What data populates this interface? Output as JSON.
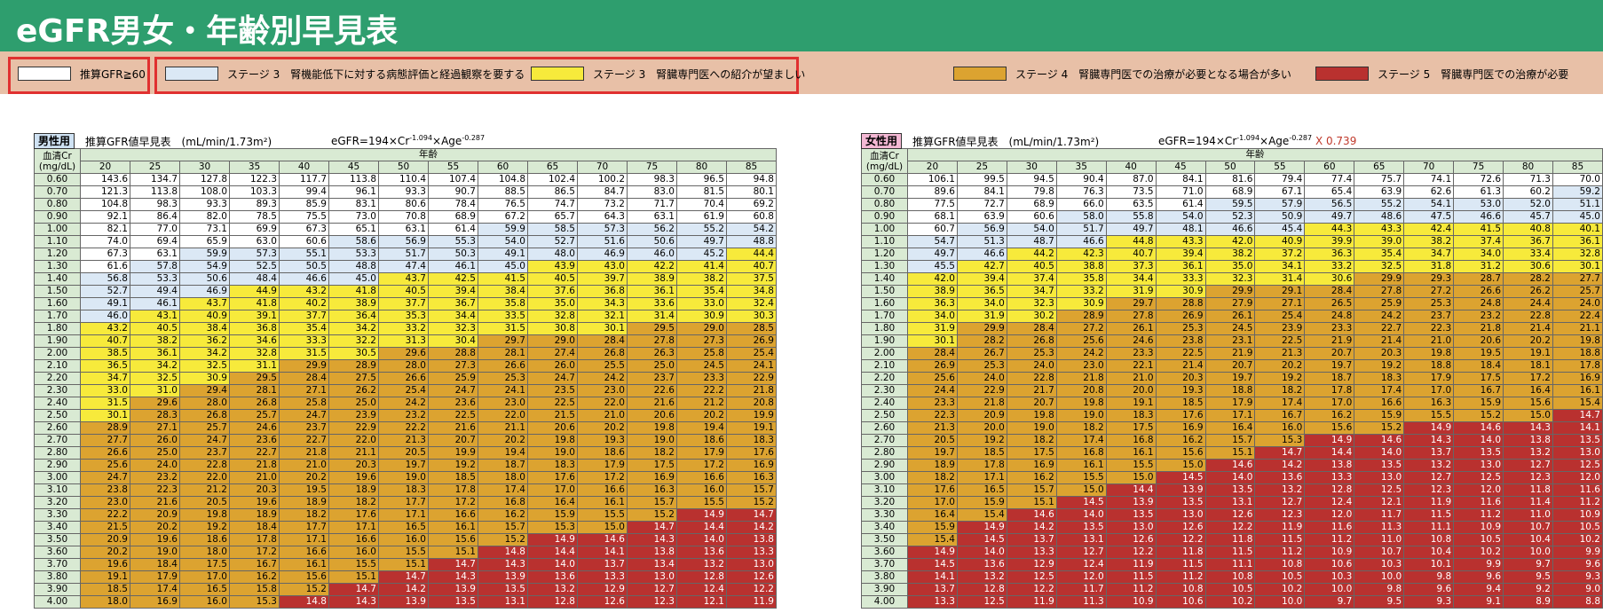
{
  "title": "eGFR男女・年齢別早見表",
  "legend": [
    {
      "label": "推算GFR≧60",
      "color": "#ffffff"
    },
    {
      "label": "ステージ 3　腎機能低下に対する病態評価と経過観察を要する",
      "color": "#dbe8f5"
    },
    {
      "label": "ステージ 3　腎臓専門医への紹介が望ましい",
      "color": "#f7ea3b"
    },
    {
      "label": "ステージ 4　腎臓専門医での治療が必要となる場合が多い",
      "color": "#dca330"
    },
    {
      "label": "ステージ 5　腎臓専門医での治療が必要",
      "color": "#b9312f"
    }
  ],
  "common": {
    "table_title": "推算GFR値早見表　(mL/min/1.73m²)",
    "cr_label_line1": "血清Cr",
    "cr_label_line2": "(mg/dL)",
    "age_label": "年齢",
    "ages": [
      "20",
      "25",
      "30",
      "35",
      "40",
      "45",
      "50",
      "55",
      "60",
      "65",
      "70",
      "75",
      "80",
      "85"
    ],
    "cr": [
      "0.60",
      "0.70",
      "0.80",
      "0.90",
      "1.00",
      "1.10",
      "1.20",
      "1.30",
      "1.40",
      "1.50",
      "1.60",
      "1.70",
      "1.80",
      "1.90",
      "2.00",
      "2.10",
      "2.20",
      "2.30",
      "2.40",
      "2.50",
      "2.60",
      "2.70",
      "2.80",
      "2.90",
      "3.00",
      "3.10",
      "3.20",
      "3.30",
      "3.40",
      "3.50",
      "3.60",
      "3.70",
      "3.80",
      "3.90",
      "4.00"
    ]
  },
  "male": {
    "tag": "男性用",
    "formula_base": "eGFR=194×Cr",
    "formula_exp1": "-1.094",
    "formula_mid": "×Age",
    "formula_exp2": "-0.287",
    "formula_mult": "",
    "tag_color": "#cfe2f3",
    "rows": [
      [
        "143.6",
        "134.7",
        "127.8",
        "122.3",
        "117.7",
        "113.8",
        "110.4",
        "107.4",
        "104.8",
        "102.4",
        "100.2",
        "98.3",
        "96.5",
        "94.8"
      ],
      [
        "121.3",
        "113.8",
        "108.0",
        "103.3",
        "99.4",
        "96.1",
        "93.3",
        "90.7",
        "88.5",
        "86.5",
        "84.7",
        "83.0",
        "81.5",
        "80.1"
      ],
      [
        "104.8",
        "98.3",
        "93.3",
        "89.3",
        "85.9",
        "83.1",
        "80.6",
        "78.4",
        "76.5",
        "74.7",
        "73.2",
        "71.7",
        "70.4",
        "69.2"
      ],
      [
        "92.1",
        "86.4",
        "82.0",
        "78.5",
        "75.5",
        "73.0",
        "70.8",
        "68.9",
        "67.2",
        "65.7",
        "64.3",
        "63.1",
        "61.9",
        "60.8"
      ],
      [
        "82.1",
        "77.0",
        "73.1",
        "69.9",
        "67.3",
        "65.1",
        "63.1",
        "61.4",
        "59.9",
        "58.5",
        "57.3",
        "56.2",
        "55.2",
        "54.2"
      ],
      [
        "74.0",
        "69.4",
        "65.9",
        "63.0",
        "60.6",
        "58.6",
        "56.9",
        "55.3",
        "54.0",
        "52.7",
        "51.6",
        "50.6",
        "49.7",
        "48.8"
      ],
      [
        "67.3",
        "63.1",
        "59.9",
        "57.3",
        "55.1",
        "53.3",
        "51.7",
        "50.3",
        "49.1",
        "48.0",
        "46.9",
        "46.0",
        "45.2",
        "44.4"
      ],
      [
        "61.6",
        "57.8",
        "54.9",
        "52.5",
        "50.5",
        "48.8",
        "47.4",
        "46.1",
        "45.0",
        "43.9",
        "43.0",
        "42.2",
        "41.4",
        "40.7"
      ],
      [
        "56.8",
        "53.3",
        "50.6",
        "48.4",
        "46.6",
        "45.0",
        "43.7",
        "42.5",
        "41.5",
        "40.5",
        "39.7",
        "38.9",
        "38.2",
        "37.5"
      ],
      [
        "52.7",
        "49.4",
        "46.9",
        "44.9",
        "43.2",
        "41.8",
        "40.5",
        "39.4",
        "38.4",
        "37.6",
        "36.8",
        "36.1",
        "35.4",
        "34.8"
      ],
      [
        "49.1",
        "46.1",
        "43.7",
        "41.8",
        "40.2",
        "38.9",
        "37.7",
        "36.7",
        "35.8",
        "35.0",
        "34.3",
        "33.6",
        "33.0",
        "32.4"
      ],
      [
        "46.0",
        "43.1",
        "40.9",
        "39.1",
        "37.7",
        "36.4",
        "35.3",
        "34.4",
        "33.5",
        "32.8",
        "32.1",
        "31.4",
        "30.9",
        "30.3"
      ],
      [
        "43.2",
        "40.5",
        "38.4",
        "36.8",
        "35.4",
        "34.2",
        "33.2",
        "32.3",
        "31.5",
        "30.8",
        "30.1",
        "29.5",
        "29.0",
        "28.5"
      ],
      [
        "40.7",
        "38.2",
        "36.2",
        "34.6",
        "33.3",
        "32.2",
        "31.3",
        "30.4",
        "29.7",
        "29.0",
        "28.4",
        "27.8",
        "27.3",
        "26.9"
      ],
      [
        "38.5",
        "36.1",
        "34.2",
        "32.8",
        "31.5",
        "30.5",
        "29.6",
        "28.8",
        "28.1",
        "27.4",
        "26.8",
        "26.3",
        "25.8",
        "25.4"
      ],
      [
        "36.5",
        "34.2",
        "32.5",
        "31.1",
        "29.9",
        "28.9",
        "28.0",
        "27.3",
        "26.6",
        "26.0",
        "25.5",
        "25.0",
        "24.5",
        "24.1"
      ],
      [
        "34.7",
        "32.5",
        "30.9",
        "29.5",
        "28.4",
        "27.5",
        "26.6",
        "25.9",
        "25.3",
        "24.7",
        "24.2",
        "23.7",
        "23.3",
        "22.9"
      ],
      [
        "33.0",
        "31.0",
        "29.4",
        "28.1",
        "27.1",
        "26.2",
        "25.4",
        "24.7",
        "24.1",
        "23.5",
        "23.0",
        "22.6",
        "22.2",
        "21.8"
      ],
      [
        "31.5",
        "29.6",
        "28.0",
        "26.8",
        "25.8",
        "25.0",
        "24.2",
        "23.6",
        "23.0",
        "22.5",
        "22.0",
        "21.6",
        "21.2",
        "20.8"
      ],
      [
        "30.1",
        "28.3",
        "26.8",
        "25.7",
        "24.7",
        "23.9",
        "23.2",
        "22.5",
        "22.0",
        "21.5",
        "21.0",
        "20.6",
        "20.2",
        "19.9"
      ],
      [
        "28.9",
        "27.1",
        "25.7",
        "24.6",
        "23.7",
        "22.9",
        "22.2",
        "21.6",
        "21.1",
        "20.6",
        "20.2",
        "19.8",
        "19.4",
        "19.1"
      ],
      [
        "27.7",
        "26.0",
        "24.7",
        "23.6",
        "22.7",
        "22.0",
        "21.3",
        "20.7",
        "20.2",
        "19.8",
        "19.3",
        "19.0",
        "18.6",
        "18.3"
      ],
      [
        "26.6",
        "25.0",
        "23.7",
        "22.7",
        "21.8",
        "21.1",
        "20.5",
        "19.9",
        "19.4",
        "19.0",
        "18.6",
        "18.2",
        "17.9",
        "17.6"
      ],
      [
        "25.6",
        "24.0",
        "22.8",
        "21.8",
        "21.0",
        "20.3",
        "19.7",
        "19.2",
        "18.7",
        "18.3",
        "17.9",
        "17.5",
        "17.2",
        "16.9"
      ],
      [
        "24.7",
        "23.2",
        "22.0",
        "21.0",
        "20.2",
        "19.6",
        "19.0",
        "18.5",
        "18.0",
        "17.6",
        "17.2",
        "16.9",
        "16.6",
        "16.3"
      ],
      [
        "23.8",
        "22.3",
        "21.2",
        "20.3",
        "19.5",
        "18.9",
        "18.3",
        "17.8",
        "17.4",
        "17.0",
        "16.6",
        "16.3",
        "16.0",
        "15.7"
      ],
      [
        "23.0",
        "21.6",
        "20.5",
        "19.6",
        "18.9",
        "18.2",
        "17.7",
        "17.2",
        "16.8",
        "16.4",
        "16.1",
        "15.7",
        "15.5",
        "15.2"
      ],
      [
        "22.2",
        "20.9",
        "19.8",
        "18.9",
        "18.2",
        "17.6",
        "17.1",
        "16.6",
        "16.2",
        "15.9",
        "15.5",
        "15.2",
        "14.9",
        "14.7"
      ],
      [
        "21.5",
        "20.2",
        "19.2",
        "18.4",
        "17.7",
        "17.1",
        "16.5",
        "16.1",
        "15.7",
        "15.3",
        "15.0",
        "14.7",
        "14.4",
        "14.2"
      ],
      [
        "20.9",
        "19.6",
        "18.6",
        "17.8",
        "17.1",
        "16.6",
        "16.0",
        "15.6",
        "15.2",
        "14.9",
        "14.6",
        "14.3",
        "14.0",
        "13.8"
      ],
      [
        "20.2",
        "19.0",
        "18.0",
        "17.2",
        "16.6",
        "16.0",
        "15.5",
        "15.1",
        "14.8",
        "14.4",
        "14.1",
        "13.8",
        "13.6",
        "13.3"
      ],
      [
        "19.6",
        "18.4",
        "17.5",
        "16.7",
        "16.1",
        "15.5",
        "15.1",
        "14.7",
        "14.3",
        "14.0",
        "13.7",
        "13.4",
        "13.2",
        "13.0"
      ],
      [
        "19.1",
        "17.9",
        "17.0",
        "16.2",
        "15.6",
        "15.1",
        "14.7",
        "14.3",
        "13.9",
        "13.6",
        "13.3",
        "13.0",
        "12.8",
        "12.6"
      ],
      [
        "18.5",
        "17.4",
        "16.5",
        "15.8",
        "15.2",
        "14.7",
        "14.2",
        "13.9",
        "13.5",
        "13.2",
        "12.9",
        "12.7",
        "12.4",
        "12.2"
      ],
      [
        "18.0",
        "16.9",
        "16.0",
        "15.3",
        "14.8",
        "14.3",
        "13.9",
        "13.5",
        "13.1",
        "12.8",
        "12.6",
        "12.3",
        "12.1",
        "11.9"
      ]
    ]
  },
  "female": {
    "tag": "女性用",
    "formula_base": "eGFR=194×Cr",
    "formula_exp1": "-1.094",
    "formula_mid": "×Age",
    "formula_exp2": "-0.287",
    "formula_mult": "X 0.739",
    "tag_color": "#f4b8d4",
    "rows": [
      [
        "106.1",
        "99.5",
        "94.5",
        "90.4",
        "87.0",
        "84.1",
        "81.6",
        "79.4",
        "77.4",
        "75.7",
        "74.1",
        "72.6",
        "71.3",
        "70.0"
      ],
      [
        "89.6",
        "84.1",
        "79.8",
        "76.3",
        "73.5",
        "71.0",
        "68.9",
        "67.1",
        "65.4",
        "63.9",
        "62.6",
        "61.3",
        "60.2",
        "59.2"
      ],
      [
        "77.5",
        "72.7",
        "68.9",
        "66.0",
        "63.5",
        "61.4",
        "59.5",
        "57.9",
        "56.5",
        "55.2",
        "54.1",
        "53.0",
        "52.0",
        "51.1"
      ],
      [
        "68.1",
        "63.9",
        "60.6",
        "58.0",
        "55.8",
        "54.0",
        "52.3",
        "50.9",
        "49.7",
        "48.6",
        "47.5",
        "46.6",
        "45.7",
        "45.0"
      ],
      [
        "60.7",
        "56.9",
        "54.0",
        "51.7",
        "49.7",
        "48.1",
        "46.6",
        "45.4",
        "44.3",
        "43.3",
        "42.4",
        "41.5",
        "40.8",
        "40.1"
      ],
      [
        "54.7",
        "51.3",
        "48.7",
        "46.6",
        "44.8",
        "43.3",
        "42.0",
        "40.9",
        "39.9",
        "39.0",
        "38.2",
        "37.4",
        "36.7",
        "36.1"
      ],
      [
        "49.7",
        "46.6",
        "44.2",
        "42.3",
        "40.7",
        "39.4",
        "38.2",
        "37.2",
        "36.3",
        "35.4",
        "34.7",
        "34.0",
        "33.4",
        "32.8"
      ],
      [
        "45.5",
        "42.7",
        "40.5",
        "38.8",
        "37.3",
        "36.1",
        "35.0",
        "34.1",
        "33.2",
        "32.5",
        "31.8",
        "31.2",
        "30.6",
        "30.1"
      ],
      [
        "42.0",
        "39.4",
        "37.4",
        "35.8",
        "34.4",
        "33.3",
        "32.3",
        "31.4",
        "30.6",
        "29.9",
        "29.3",
        "28.7",
        "28.2",
        "27.7"
      ],
      [
        "38.9",
        "36.5",
        "34.7",
        "33.2",
        "31.9",
        "30.9",
        "29.9",
        "29.1",
        "28.4",
        "27.8",
        "27.2",
        "26.6",
        "26.2",
        "25.7"
      ],
      [
        "36.3",
        "34.0",
        "32.3",
        "30.9",
        "29.7",
        "28.8",
        "27.9",
        "27.1",
        "26.5",
        "25.9",
        "25.3",
        "24.8",
        "24.4",
        "24.0"
      ],
      [
        "34.0",
        "31.9",
        "30.2",
        "28.9",
        "27.8",
        "26.9",
        "26.1",
        "25.4",
        "24.8",
        "24.2",
        "23.7",
        "23.2",
        "22.8",
        "22.4"
      ],
      [
        "31.9",
        "29.9",
        "28.4",
        "27.2",
        "26.1",
        "25.3",
        "24.5",
        "23.9",
        "23.3",
        "22.7",
        "22.3",
        "21.8",
        "21.4",
        "21.1"
      ],
      [
        "30.1",
        "28.2",
        "26.8",
        "25.6",
        "24.6",
        "23.8",
        "23.1",
        "22.5",
        "21.9",
        "21.4",
        "21.0",
        "20.6",
        "20.2",
        "19.8"
      ],
      [
        "28.4",
        "26.7",
        "25.3",
        "24.2",
        "23.3",
        "22.5",
        "21.9",
        "21.3",
        "20.7",
        "20.3",
        "19.8",
        "19.5",
        "19.1",
        "18.8"
      ],
      [
        "26.9",
        "25.3",
        "24.0",
        "23.0",
        "22.1",
        "21.4",
        "20.7",
        "20.2",
        "19.7",
        "19.2",
        "18.8",
        "18.4",
        "18.1",
        "17.8"
      ],
      [
        "25.6",
        "24.0",
        "22.8",
        "21.8",
        "21.0",
        "20.3",
        "19.7",
        "19.2",
        "18.7",
        "18.3",
        "17.9",
        "17.5",
        "17.2",
        "16.9"
      ],
      [
        "24.4",
        "22.9",
        "21.7",
        "20.8",
        "20.0",
        "19.3",
        "18.8",
        "18.2",
        "17.8",
        "17.4",
        "17.0",
        "16.7",
        "16.4",
        "16.1"
      ],
      [
        "23.3",
        "21.8",
        "20.7",
        "19.8",
        "19.1",
        "18.5",
        "17.9",
        "17.4",
        "17.0",
        "16.6",
        "16.3",
        "15.9",
        "15.6",
        "15.4"
      ],
      [
        "22.3",
        "20.9",
        "19.8",
        "19.0",
        "18.3",
        "17.6",
        "17.1",
        "16.7",
        "16.2",
        "15.9",
        "15.5",
        "15.2",
        "15.0",
        "14.7"
      ],
      [
        "21.3",
        "20.0",
        "19.0",
        "18.2",
        "17.5",
        "16.9",
        "16.4",
        "16.0",
        "15.6",
        "15.2",
        "14.9",
        "14.6",
        "14.3",
        "14.1"
      ],
      [
        "20.5",
        "19.2",
        "18.2",
        "17.4",
        "16.8",
        "16.2",
        "15.7",
        "15.3",
        "14.9",
        "14.6",
        "14.3",
        "14.0",
        "13.8",
        "13.5"
      ],
      [
        "19.7",
        "18.5",
        "17.5",
        "16.8",
        "16.1",
        "15.6",
        "15.1",
        "14.7",
        "14.4",
        "14.0",
        "13.7",
        "13.5",
        "13.2",
        "13.0"
      ],
      [
        "18.9",
        "17.8",
        "16.9",
        "16.1",
        "15.5",
        "15.0",
        "14.6",
        "14.2",
        "13.8",
        "13.5",
        "13.2",
        "13.0",
        "12.7",
        "12.5"
      ],
      [
        "18.2",
        "17.1",
        "16.2",
        "15.5",
        "15.0",
        "14.5",
        "14.0",
        "13.6",
        "13.3",
        "13.0",
        "12.7",
        "12.5",
        "12.3",
        "12.0"
      ],
      [
        "17.6",
        "16.5",
        "15.7",
        "15.0",
        "14.4",
        "13.9",
        "13.5",
        "13.2",
        "12.8",
        "12.5",
        "12.3",
        "12.0",
        "11.8",
        "11.6"
      ],
      [
        "17.0",
        "15.9",
        "15.1",
        "14.5",
        "13.9",
        "13.5",
        "13.1",
        "12.7",
        "12.4",
        "12.1",
        "11.9",
        "11.6",
        "11.4",
        "11.2"
      ],
      [
        "16.4",
        "15.4",
        "14.6",
        "14.0",
        "13.5",
        "13.0",
        "12.6",
        "12.3",
        "12.0",
        "11.7",
        "11.5",
        "11.2",
        "11.0",
        "10.9"
      ],
      [
        "15.9",
        "14.9",
        "14.2",
        "13.5",
        "13.0",
        "12.6",
        "12.2",
        "11.9",
        "11.6",
        "11.3",
        "11.1",
        "10.9",
        "10.7",
        "10.5"
      ],
      [
        "15.4",
        "14.5",
        "13.7",
        "13.1",
        "12.6",
        "12.2",
        "11.8",
        "11.5",
        "11.2",
        "11.0",
        "10.8",
        "10.5",
        "10.4",
        "10.2"
      ],
      [
        "14.9",
        "14.0",
        "13.3",
        "12.7",
        "12.2",
        "11.8",
        "11.5",
        "11.2",
        "10.9",
        "10.7",
        "10.4",
        "10.2",
        "10.0",
        "9.9"
      ],
      [
        "14.5",
        "13.6",
        "12.9",
        "12.4",
        "11.9",
        "11.5",
        "11.1",
        "10.8",
        "10.6",
        "10.3",
        "10.1",
        "9.9",
        "9.7",
        "9.6"
      ],
      [
        "14.1",
        "13.2",
        "12.5",
        "12.0",
        "11.5",
        "11.2",
        "10.8",
        "10.5",
        "10.3",
        "10.0",
        "9.8",
        "9.6",
        "9.5",
        "9.3"
      ],
      [
        "13.7",
        "12.8",
        "12.2",
        "11.7",
        "11.2",
        "10.8",
        "10.5",
        "10.2",
        "10.0",
        "9.8",
        "9.6",
        "9.4",
        "9.2",
        "9.0"
      ],
      [
        "13.3",
        "12.5",
        "11.9",
        "11.3",
        "10.9",
        "10.6",
        "10.2",
        "10.0",
        "9.7",
        "9.5",
        "9.3",
        "9.1",
        "8.9",
        "8.8"
      ]
    ]
  }
}
